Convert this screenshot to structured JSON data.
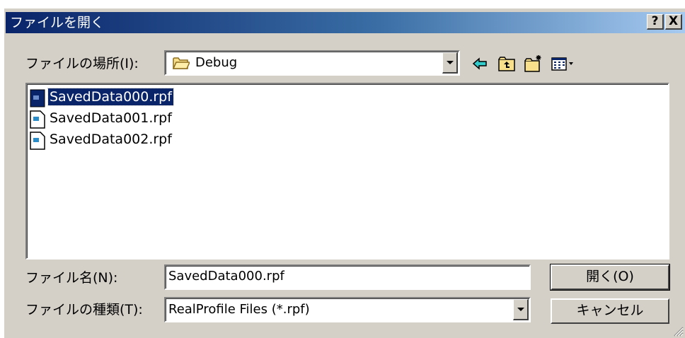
{
  "dialog": {
    "title": "ファイルを開く",
    "help_button": "?",
    "close_button": "X"
  },
  "location": {
    "label": "ファイルの場所(I):",
    "value": "Debug"
  },
  "toolbar": {
    "back_icon": "arrow-left-icon",
    "up_icon": "folder-up-icon",
    "new_folder_icon": "new-folder-icon",
    "view_menu_icon": "view-menu-icon"
  },
  "files": [
    {
      "name": "SavedData000.rpf",
      "selected": true
    },
    {
      "name": "SavedData001.rpf",
      "selected": false
    },
    {
      "name": "SavedData002.rpf",
      "selected": false
    }
  ],
  "filename": {
    "label": "ファイル名(N):",
    "value": "SavedData000.rpf"
  },
  "filetype": {
    "label": "ファイルの種類(T):",
    "value": "RealProfile Files (*.rpf)"
  },
  "buttons": {
    "open": "開く(O)",
    "cancel": "キャンセル"
  },
  "colors": {
    "title_start": "#0a246a",
    "title_end": "#a6caf0",
    "face": "#d4d0c8",
    "selection": "#0a246a"
  }
}
